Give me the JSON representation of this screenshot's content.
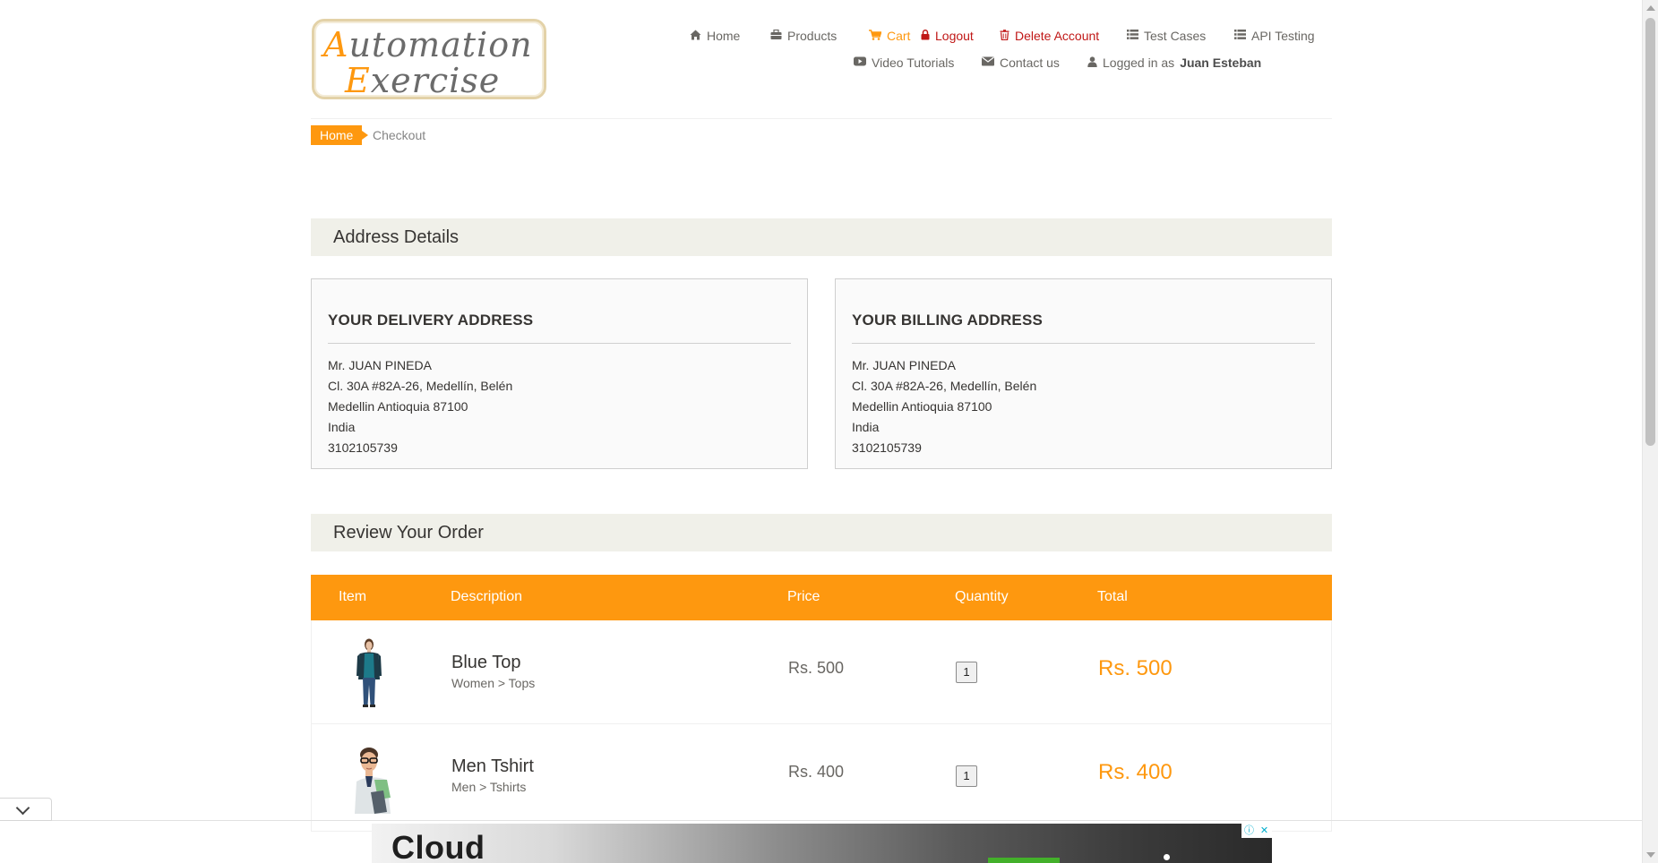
{
  "logo": {
    "line1_cap": "A",
    "line1_rest": "utomation",
    "line2_cap": "E",
    "line2_rest": "xercise"
  },
  "nav": {
    "home": "Home",
    "products": "Products",
    "cart": "Cart",
    "logout": "Logout",
    "delete_account": "Delete Account",
    "test_cases": "Test Cases",
    "api_testing": "API Testing",
    "video_tutorials": "Video Tutorials",
    "contact_us": "Contact us",
    "logged_in_prefix": "Logged in as",
    "logged_in_user": "Juan Esteban"
  },
  "breadcrumb": {
    "home": "Home",
    "current": "Checkout"
  },
  "address_section": {
    "title": "Address Details",
    "delivery": {
      "heading": "YOUR DELIVERY ADDRESS",
      "lines": [
        "Mr. JUAN PINEDA",
        "Cl. 30A #82A-26, Medellín, Belén",
        "Medellin Antioquia 87100",
        "India",
        "3102105739"
      ]
    },
    "billing": {
      "heading": "YOUR BILLING ADDRESS",
      "lines": [
        "Mr. JUAN PINEDA",
        "Cl. 30A #82A-26, Medellín, Belén",
        "Medellin Antioquia 87100",
        "India",
        "3102105739"
      ]
    }
  },
  "order_section": {
    "title": "Review Your Order",
    "columns": {
      "item": "Item",
      "description": "Description",
      "price": "Price",
      "quantity": "Quantity",
      "total": "Total"
    },
    "rows": [
      {
        "name": "Blue Top",
        "category": "Women > Tops",
        "price": "Rs. 500",
        "quantity": "1",
        "total": "Rs. 500"
      },
      {
        "name": "Men Tshirt",
        "category": "Men > Tshirts",
        "price": "Rs. 400",
        "quantity": "1",
        "total": "Rs. 400"
      }
    ]
  },
  "ad": {
    "headline": "Cloud",
    "info_glyph": "ⓘ",
    "close_glyph": "✕"
  },
  "icons": {
    "home": "home-icon",
    "products": "briefcase-icon",
    "cart": "cart-icon",
    "logout": "lock-icon",
    "delete": "trash-icon",
    "test_cases": "list-icon",
    "api": "list-icon",
    "video": "youtube-icon",
    "contact": "envelope-icon",
    "user": "user-icon"
  },
  "colors": {
    "accent": "#fe980f",
    "danger": "#c01716",
    "section_bg": "#f0f0e9",
    "text": "#696763"
  }
}
